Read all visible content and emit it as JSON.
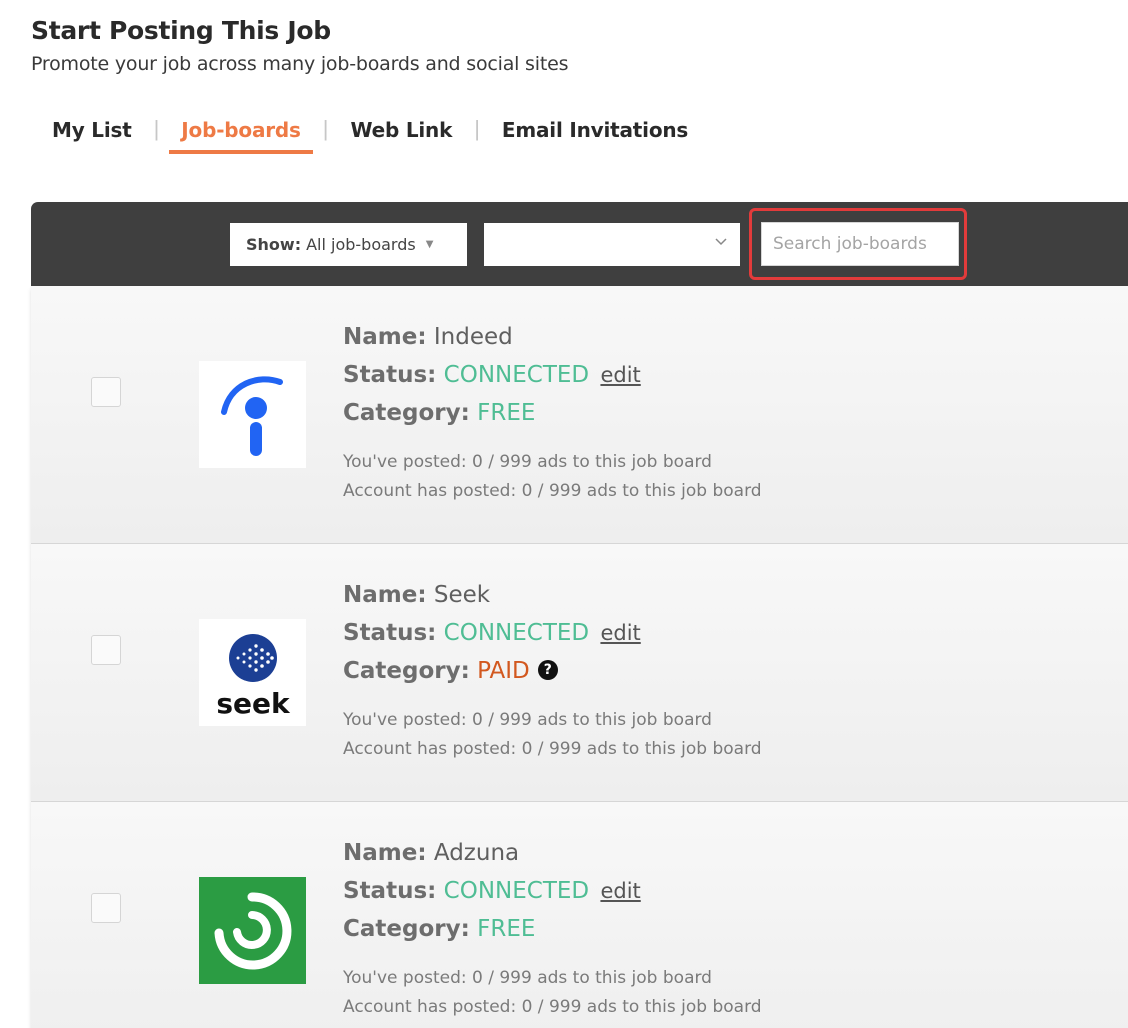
{
  "page": {
    "title": "Start Posting This Job",
    "subtitle": "Promote your job across many job-boards and social sites"
  },
  "tabs": [
    {
      "label": "My List",
      "active": false
    },
    {
      "label": "Job-boards",
      "active": true
    },
    {
      "label": "Web Link",
      "active": false
    },
    {
      "label": "Email Invitations",
      "active": false
    }
  ],
  "toolbar": {
    "show_label": "Show:",
    "show_value": "All job-boards",
    "second_select_value": "",
    "search_placeholder": "Search job-boards"
  },
  "labels": {
    "name": "Name:",
    "status": "Status:",
    "category": "Category:",
    "edit": "edit"
  },
  "boards": [
    {
      "name": "Indeed",
      "status": "CONNECTED",
      "category": "FREE",
      "posted": "You've posted: 0 / 999 ads to this job board",
      "account_posted": "Account has posted: 0 / 999 ads to this job board",
      "logo_icon": "indeed-logo-icon"
    },
    {
      "name": "Seek",
      "status": "CONNECTED",
      "category": "PAID",
      "posted": "You've posted: 0 / 999 ads to this job board",
      "account_posted": "Account has posted: 0 / 999 ads to this job board",
      "logo_icon": "seek-logo-icon",
      "logo_text": "seek"
    },
    {
      "name": "Adzuna",
      "status": "CONNECTED",
      "category": "FREE",
      "posted": "You've posted: 0 / 999 ads to this job board",
      "account_posted": "Account has posted: 0 / 999 ads to this job board",
      "logo_icon": "adzuna-logo-icon"
    }
  ],
  "colors": {
    "accent": "#ee7a45",
    "connected": "#4fbd94",
    "free": "#4fbd94",
    "paid": "#d2581f",
    "highlight_outline": "#e23b3b",
    "toolbar_bg": "#3f3f3f"
  }
}
